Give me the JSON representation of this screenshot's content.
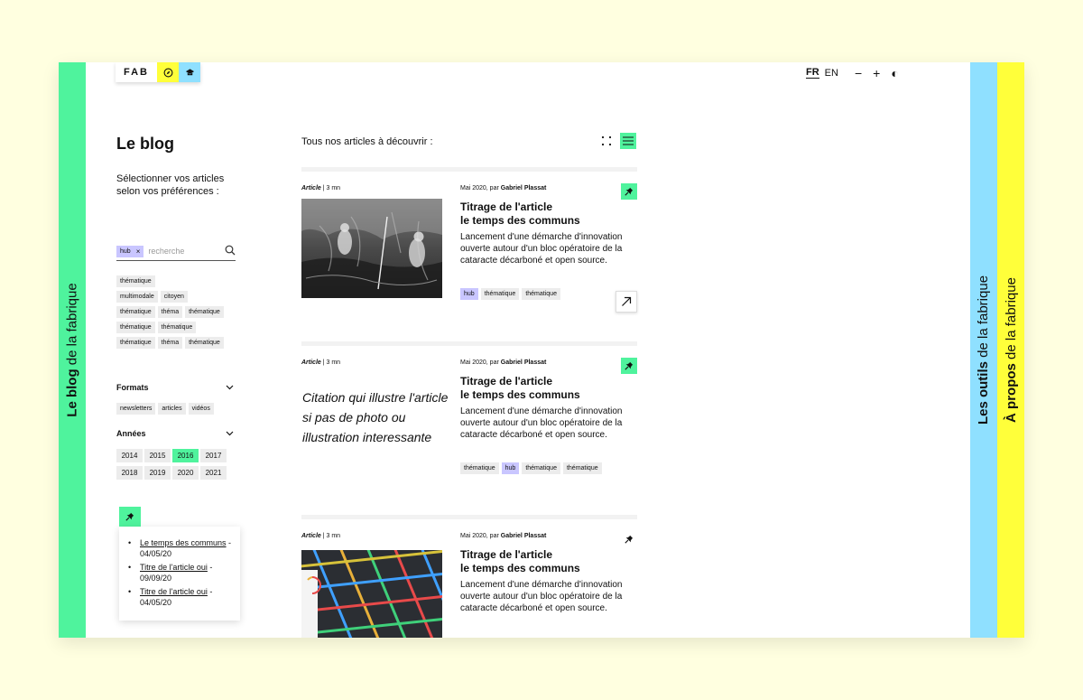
{
  "header": {
    "logo": "FAB",
    "lang_fr": "FR",
    "lang_en": "EN",
    "zoom_out": "−",
    "zoom_in": "+",
    "contrast": "◐"
  },
  "side_tabs": {
    "blog_bold": "Le blog",
    "blog_rest": " de la fabrique",
    "outils_bold": "Les outils",
    "outils_rest": " de la fabrique",
    "propos_bold": "À propos",
    "propos_rest": " de la fabrique"
  },
  "sidebar": {
    "title": "Le blog",
    "subtitle": "Sélectionner vos articles selon vos préférences :",
    "search_chip": "hub",
    "search_chip_remove": "×",
    "search_placeholder": "recherche",
    "theme_tags": [
      "thématique",
      "multimodale",
      "citoyen",
      "thématique",
      "théma",
      "thématique",
      "thématique",
      "thématique",
      "thématique",
      "théma",
      "thématique"
    ],
    "formats_label": "Formats",
    "formats": [
      "newsletters",
      "articles",
      "vidéos"
    ],
    "years_label": "Années",
    "years": [
      "2014",
      "2015",
      "2016",
      "2017",
      "2018",
      "2019",
      "2020",
      "2021"
    ],
    "active_year": "2016",
    "pinned": [
      {
        "link": "Le temps des communs",
        "date": " - 04/05/20"
      },
      {
        "link": "Titre de l'article oui",
        "date": " - 09/09/20"
      },
      {
        "link": "Titre de l'article oui",
        "date": " - 04/05/20"
      }
    ]
  },
  "main": {
    "heading": "Tous nos articles à découvrir :",
    "articles": [
      {
        "type": "Article",
        "duration": " | 3 mn",
        "date": "Mai 2020, par ",
        "author": "Gabriel Plassat",
        "title_line1": "Titrage de l'article",
        "title_line2": "le temps des communs",
        "desc": "Lancement d'une démarche d'innovation ouverte autour d'un bloc opératoire de la cataracte décarboné et open source.",
        "tags": [
          "hub",
          "thématique",
          "thématique"
        ]
      },
      {
        "type": "Article",
        "duration": " | 3 mn",
        "date": "Mai 2020, par ",
        "author": "Gabriel Plassat",
        "quote": "Citation qui illustre l'article si pas de photo ou illustration interessante",
        "title_line1": "Titrage de l'article",
        "title_line2": "le temps des communs",
        "desc": "Lancement d'une démarche d'innovation ouverte autour d'un bloc opératoire de la cataracte décarboné et open source.",
        "tags": [
          "thématique",
          "hub",
          "thématique",
          "thématique"
        ]
      },
      {
        "type": "Article",
        "duration": " | 3 mn",
        "date": "Mai 2020, par ",
        "author": "Gabriel Plassat",
        "title_line1": "Titrage de l'article",
        "title_line2": "le temps des communs",
        "desc": "Lancement d'une démarche d'innovation ouverte autour d'un bloc opératoire de la cataracte décarboné et open source."
      }
    ]
  },
  "colors": {
    "green": "#4ff39d",
    "blue": "#8fe0ff",
    "yellow": "#ffff3a",
    "hub": "#c9c6ff"
  },
  "icons": {
    "pin": "pin-icon",
    "arrow": "arrow-up-right-icon",
    "grid_view": "grid-view-icon",
    "list_view": "list-view-icon"
  }
}
